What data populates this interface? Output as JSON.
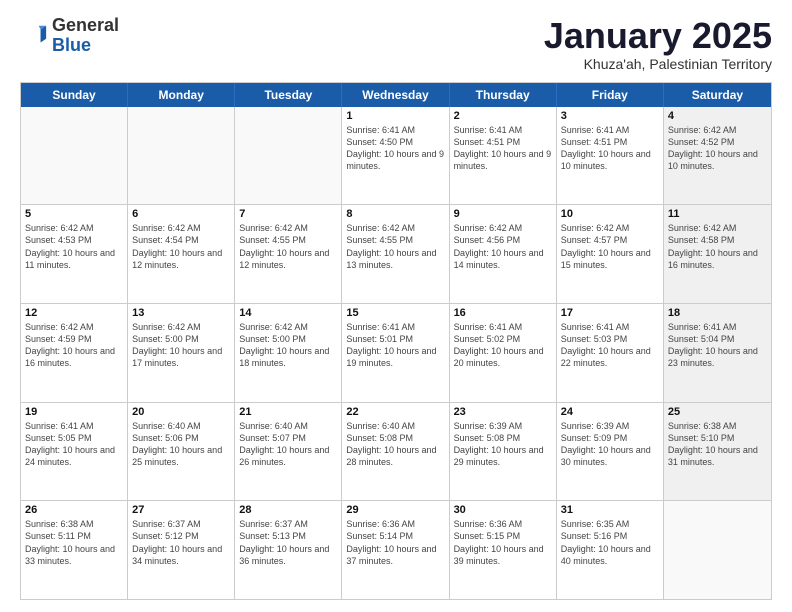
{
  "header": {
    "logo_general": "General",
    "logo_blue": "Blue",
    "month_title": "January 2025",
    "subtitle": "Khuza'ah, Palestinian Territory"
  },
  "weekdays": [
    "Sunday",
    "Monday",
    "Tuesday",
    "Wednesday",
    "Thursday",
    "Friday",
    "Saturday"
  ],
  "weeks": [
    [
      {
        "day": "",
        "info": ""
      },
      {
        "day": "",
        "info": ""
      },
      {
        "day": "",
        "info": ""
      },
      {
        "day": "1",
        "info": "Sunrise: 6:41 AM\nSunset: 4:50 PM\nDaylight: 10 hours\nand 9 minutes."
      },
      {
        "day": "2",
        "info": "Sunrise: 6:41 AM\nSunset: 4:51 PM\nDaylight: 10 hours\nand 9 minutes."
      },
      {
        "day": "3",
        "info": "Sunrise: 6:41 AM\nSunset: 4:51 PM\nDaylight: 10 hours\nand 10 minutes."
      },
      {
        "day": "4",
        "info": "Sunrise: 6:42 AM\nSunset: 4:52 PM\nDaylight: 10 hours\nand 10 minutes."
      }
    ],
    [
      {
        "day": "5",
        "info": "Sunrise: 6:42 AM\nSunset: 4:53 PM\nDaylight: 10 hours\nand 11 minutes."
      },
      {
        "day": "6",
        "info": "Sunrise: 6:42 AM\nSunset: 4:54 PM\nDaylight: 10 hours\nand 12 minutes."
      },
      {
        "day": "7",
        "info": "Sunrise: 6:42 AM\nSunset: 4:55 PM\nDaylight: 10 hours\nand 12 minutes."
      },
      {
        "day": "8",
        "info": "Sunrise: 6:42 AM\nSunset: 4:55 PM\nDaylight: 10 hours\nand 13 minutes."
      },
      {
        "day": "9",
        "info": "Sunrise: 6:42 AM\nSunset: 4:56 PM\nDaylight: 10 hours\nand 14 minutes."
      },
      {
        "day": "10",
        "info": "Sunrise: 6:42 AM\nSunset: 4:57 PM\nDaylight: 10 hours\nand 15 minutes."
      },
      {
        "day": "11",
        "info": "Sunrise: 6:42 AM\nSunset: 4:58 PM\nDaylight: 10 hours\nand 16 minutes."
      }
    ],
    [
      {
        "day": "12",
        "info": "Sunrise: 6:42 AM\nSunset: 4:59 PM\nDaylight: 10 hours\nand 16 minutes."
      },
      {
        "day": "13",
        "info": "Sunrise: 6:42 AM\nSunset: 5:00 PM\nDaylight: 10 hours\nand 17 minutes."
      },
      {
        "day": "14",
        "info": "Sunrise: 6:42 AM\nSunset: 5:00 PM\nDaylight: 10 hours\nand 18 minutes."
      },
      {
        "day": "15",
        "info": "Sunrise: 6:41 AM\nSunset: 5:01 PM\nDaylight: 10 hours\nand 19 minutes."
      },
      {
        "day": "16",
        "info": "Sunrise: 6:41 AM\nSunset: 5:02 PM\nDaylight: 10 hours\nand 20 minutes."
      },
      {
        "day": "17",
        "info": "Sunrise: 6:41 AM\nSunset: 5:03 PM\nDaylight: 10 hours\nand 22 minutes."
      },
      {
        "day": "18",
        "info": "Sunrise: 6:41 AM\nSunset: 5:04 PM\nDaylight: 10 hours\nand 23 minutes."
      }
    ],
    [
      {
        "day": "19",
        "info": "Sunrise: 6:41 AM\nSunset: 5:05 PM\nDaylight: 10 hours\nand 24 minutes."
      },
      {
        "day": "20",
        "info": "Sunrise: 6:40 AM\nSunset: 5:06 PM\nDaylight: 10 hours\nand 25 minutes."
      },
      {
        "day": "21",
        "info": "Sunrise: 6:40 AM\nSunset: 5:07 PM\nDaylight: 10 hours\nand 26 minutes."
      },
      {
        "day": "22",
        "info": "Sunrise: 6:40 AM\nSunset: 5:08 PM\nDaylight: 10 hours\nand 28 minutes."
      },
      {
        "day": "23",
        "info": "Sunrise: 6:39 AM\nSunset: 5:08 PM\nDaylight: 10 hours\nand 29 minutes."
      },
      {
        "day": "24",
        "info": "Sunrise: 6:39 AM\nSunset: 5:09 PM\nDaylight: 10 hours\nand 30 minutes."
      },
      {
        "day": "25",
        "info": "Sunrise: 6:38 AM\nSunset: 5:10 PM\nDaylight: 10 hours\nand 31 minutes."
      }
    ],
    [
      {
        "day": "26",
        "info": "Sunrise: 6:38 AM\nSunset: 5:11 PM\nDaylight: 10 hours\nand 33 minutes."
      },
      {
        "day": "27",
        "info": "Sunrise: 6:37 AM\nSunset: 5:12 PM\nDaylight: 10 hours\nand 34 minutes."
      },
      {
        "day": "28",
        "info": "Sunrise: 6:37 AM\nSunset: 5:13 PM\nDaylight: 10 hours\nand 36 minutes."
      },
      {
        "day": "29",
        "info": "Sunrise: 6:36 AM\nSunset: 5:14 PM\nDaylight: 10 hours\nand 37 minutes."
      },
      {
        "day": "30",
        "info": "Sunrise: 6:36 AM\nSunset: 5:15 PM\nDaylight: 10 hours\nand 39 minutes."
      },
      {
        "day": "31",
        "info": "Sunrise: 6:35 AM\nSunset: 5:16 PM\nDaylight: 10 hours\nand 40 minutes."
      },
      {
        "day": "",
        "info": ""
      }
    ]
  ]
}
